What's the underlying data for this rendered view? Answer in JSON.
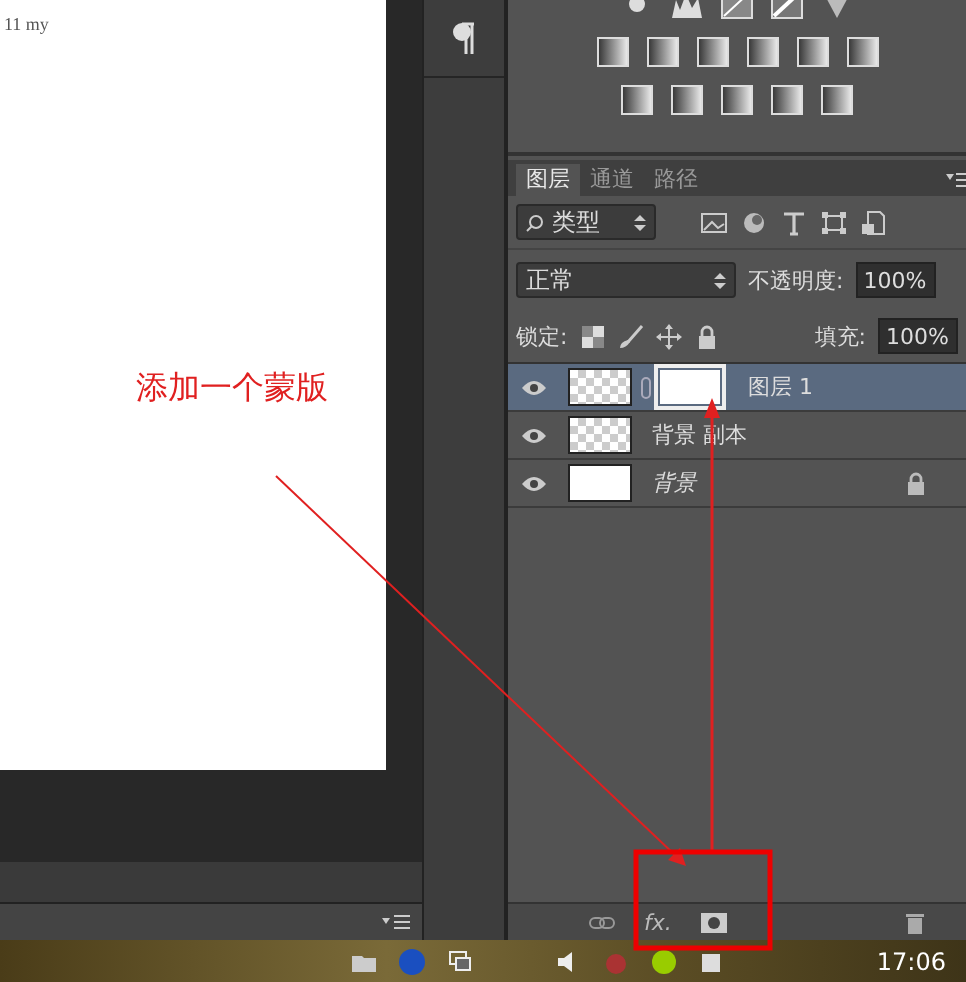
{
  "document": {
    "text": "11 my"
  },
  "annotation": {
    "label": "添加一个蒙版"
  },
  "layers_panel": {
    "tabs": [
      {
        "label": "图层",
        "selected": true
      },
      {
        "label": "通道",
        "selected": false
      },
      {
        "label": "路径",
        "selected": false
      }
    ],
    "filter": {
      "value": "类型"
    },
    "blend_mode": {
      "value": "正常"
    },
    "opacity": {
      "label": "不透明度:",
      "value": "100%"
    },
    "lock": {
      "label": "锁定:"
    },
    "fill": {
      "label": "填充:",
      "value": "100%"
    },
    "layers": [
      {
        "name": "图层 1",
        "kind": "layer",
        "selected": true,
        "visible": true,
        "has_mask": true,
        "locked": false
      },
      {
        "name": "背景 副本",
        "kind": "layer",
        "selected": false,
        "visible": true,
        "has_mask": false,
        "locked": false
      },
      {
        "name": "背景",
        "kind": "background",
        "selected": false,
        "visible": true,
        "has_mask": false,
        "locked": true
      }
    ],
    "footer": {
      "fx": "fx."
    }
  },
  "taskbar": {
    "time": "17:06"
  }
}
